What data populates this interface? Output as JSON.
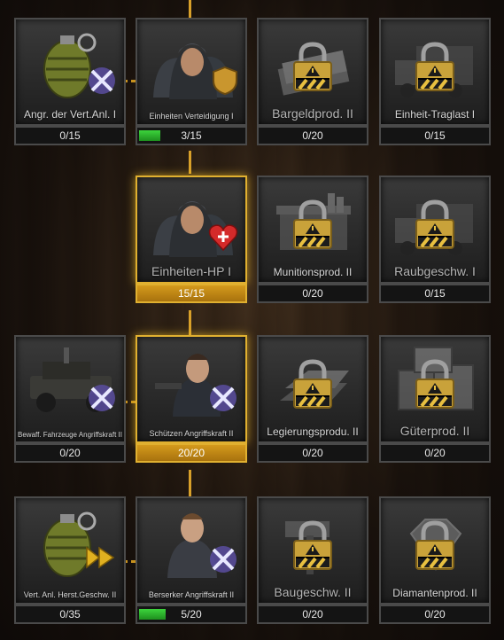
{
  "rows": [
    [
      {
        "label": "Angr. der Vert.Anl. I",
        "progress": "0/15",
        "level": 0,
        "icon": "grenade-icon",
        "badge": "crossed-swords-icon",
        "locked": false,
        "active": false,
        "style": "normal"
      },
      {
        "label": "Einheiten Verteidigung I",
        "progress": "3/15",
        "level": 0.2,
        "icon": "gang-members-icon",
        "badge": "shield-icon",
        "locked": false,
        "active": false,
        "style": "small"
      },
      {
        "label": "Bargeldprod. II",
        "progress": "0/20",
        "level": 0,
        "icon": "cash-stack-icon",
        "badge": "padlock-icon",
        "locked": true,
        "active": false,
        "style": "big"
      },
      {
        "label": "Einheit-Traglast I",
        "progress": "0/15",
        "level": 0,
        "icon": "truck-icon",
        "badge": "padlock-icon",
        "locked": true,
        "active": false,
        "style": "normal"
      }
    ],
    [
      {
        "label": "Einheiten-HP I",
        "progress": "15/15",
        "level": 1,
        "icon": "gang-members-icon",
        "badge": "heart-plus-icon",
        "locked": false,
        "active": true,
        "style": "big"
      },
      {
        "label": "Munitionsprod. II",
        "progress": "0/20",
        "level": 0,
        "icon": "ammo-crate-icon",
        "badge": "padlock-icon",
        "locked": true,
        "active": false,
        "style": "normal"
      },
      {
        "label": "Raubgeschw. I",
        "progress": "0/15",
        "level": 0,
        "icon": "truck-icon",
        "badge": "padlock-icon",
        "locked": true,
        "active": false,
        "style": "big"
      }
    ],
    [
      {
        "label": "Bewaff. Fahrzeuge Angriffskraft II",
        "progress": "0/20",
        "level": 0,
        "icon": "armed-jeep-icon",
        "badge": "crossed-swords-icon",
        "locked": false,
        "active": false,
        "style": "two"
      },
      {
        "label": "Schützen Angriffskraft II",
        "progress": "20/20",
        "level": 1,
        "icon": "gunman-icon",
        "badge": "crossed-swords-icon",
        "locked": false,
        "active": true,
        "style": "small"
      },
      {
        "label": "Legierungsprodu. II",
        "progress": "0/20",
        "level": 0,
        "icon": "alloy-ingot-icon",
        "badge": "padlock-icon",
        "locked": true,
        "active": false,
        "style": "normal"
      },
      {
        "label": "Güterprod. II",
        "progress": "0/20",
        "level": 0,
        "icon": "wooden-crates-icon",
        "badge": "padlock-icon",
        "locked": true,
        "active": false,
        "style": "big"
      }
    ],
    [
      {
        "label": "Vert. Anl. Herst.Geschw. II",
        "progress": "0/35",
        "level": 0,
        "icon": "grenade-icon",
        "badge": "speed-arrow-icon",
        "locked": false,
        "active": false,
        "style": "small"
      },
      {
        "label": "Berserker Angriffskraft II",
        "progress": "5/20",
        "level": 0.25,
        "icon": "berserker-icon",
        "badge": "crossed-swords-icon",
        "locked": false,
        "active": false,
        "style": "small"
      },
      {
        "label": "Baugeschw. II",
        "progress": "0/20",
        "level": 0,
        "icon": "hammer-icon",
        "badge": "padlock-icon",
        "locked": true,
        "active": false,
        "style": "big"
      },
      {
        "label": "Diamantenprod. II",
        "progress": "0/20",
        "level": 0,
        "icon": "diamond-icon",
        "badge": "padlock-icon",
        "locked": true,
        "active": false,
        "style": "normal"
      }
    ]
  ],
  "colors": {
    "accent": "#e0b030",
    "progress_green": "#2fbf2f",
    "lock_gold": "#c9a23a"
  }
}
